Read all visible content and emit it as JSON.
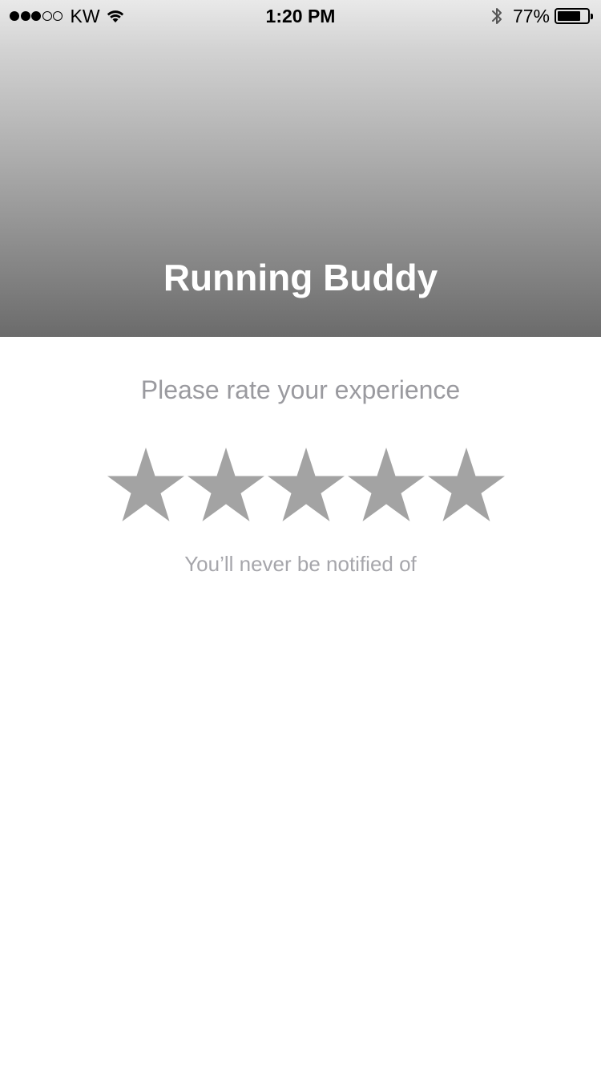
{
  "status_bar": {
    "signal_dots_filled": 3,
    "signal_dots_total": 5,
    "carrier": "KW",
    "wifi_icon": "wifi-icon",
    "time": "1:20 PM",
    "bluetooth_icon": "bluetooth-icon",
    "battery_percent": "77%",
    "battery_level": 0.77
  },
  "header": {
    "title": "Running Buddy"
  },
  "rating": {
    "prompt": "Please rate your experience",
    "star_count": 5,
    "star_color": "#a3a3a3",
    "note": "You’ll never be notified of"
  },
  "colors": {
    "header_gradient_top": "#e9e9e9",
    "header_gradient_bottom": "#6b6b6b",
    "prompt_text": "#9a9a9f",
    "title_text": "#ffffff"
  }
}
